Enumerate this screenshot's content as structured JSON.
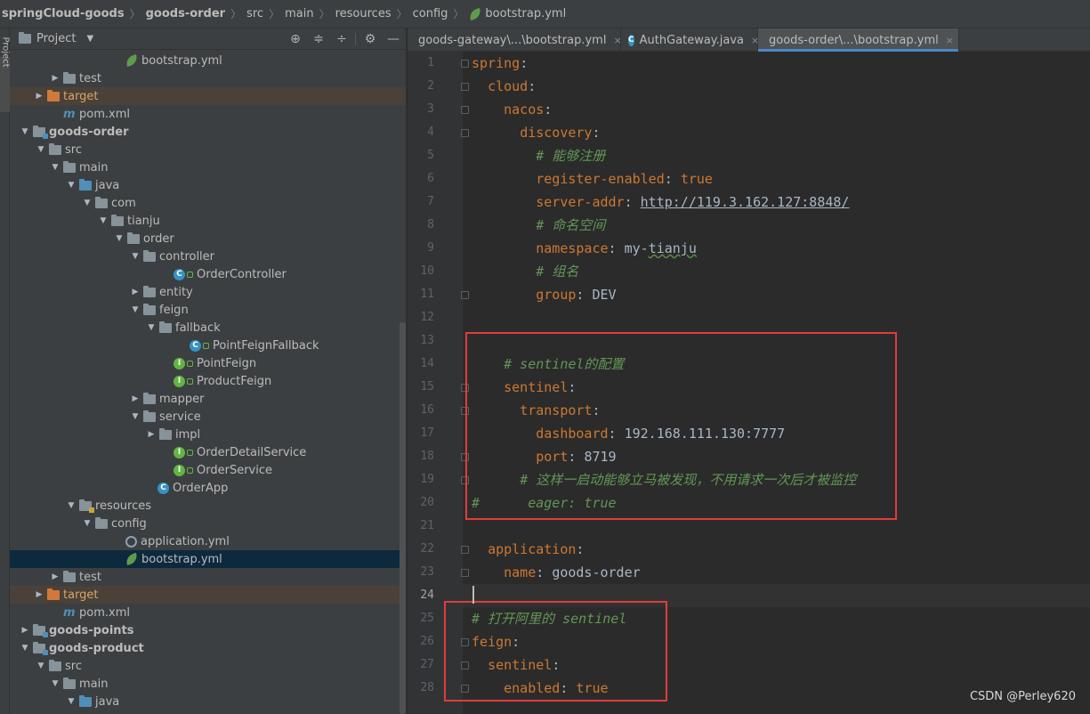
{
  "breadcrumb": [
    "springCloud-goods",
    "goods-order",
    "src",
    "main",
    "resources",
    "config",
    "bootstrap.yml"
  ],
  "tool_stripe": {
    "label": "Project"
  },
  "project_panel": {
    "title": "Project"
  },
  "tree": [
    {
      "label": "bootstrap.yml",
      "icon": "yml-icon"
    },
    {
      "label": "test",
      "icon": "folder-icon",
      "arrow": "▶"
    },
    {
      "label": "target",
      "icon": "folder-orange-icon",
      "arrow": "▶"
    },
    {
      "label": "pom.xml",
      "icon": "maven-icon"
    },
    {
      "label": "goods-order",
      "icon": "module-icon",
      "arrow": "▼"
    },
    {
      "label": "src",
      "icon": "folder-icon",
      "arrow": "▼"
    },
    {
      "label": "main",
      "icon": "folder-icon",
      "arrow": "▼"
    },
    {
      "label": "java",
      "icon": "folder-blue-icon",
      "arrow": "▼"
    },
    {
      "label": "com",
      "icon": "package-icon",
      "arrow": "▼"
    },
    {
      "label": "tianju",
      "icon": "package-icon",
      "arrow": "▼"
    },
    {
      "label": "order",
      "icon": "package-icon",
      "arrow": "▼"
    },
    {
      "label": "controller",
      "icon": "package-icon",
      "arrow": "▼"
    },
    {
      "label": "OrderController",
      "icon": "class-icon"
    },
    {
      "label": "entity",
      "icon": "package-icon",
      "arrow": "▶"
    },
    {
      "label": "feign",
      "icon": "package-icon",
      "arrow": "▼"
    },
    {
      "label": "fallback",
      "icon": "package-icon",
      "arrow": "▼"
    },
    {
      "label": "PointFeignFallback",
      "icon": "class-icon"
    },
    {
      "label": "PointFeign",
      "icon": "interface-icon"
    },
    {
      "label": "ProductFeign",
      "icon": "interface-icon"
    },
    {
      "label": "mapper",
      "icon": "package-icon",
      "arrow": "▶"
    },
    {
      "label": "service",
      "icon": "package-icon",
      "arrow": "▼"
    },
    {
      "label": "impl",
      "icon": "package-icon",
      "arrow": "▶"
    },
    {
      "label": "OrderDetailService",
      "icon": "interface-icon"
    },
    {
      "label": "OrderService",
      "icon": "interface-icon"
    },
    {
      "label": "OrderApp",
      "icon": "spring-boot-app-icon"
    },
    {
      "label": "resources",
      "icon": "resources-folder-icon",
      "arrow": "▼"
    },
    {
      "label": "config",
      "icon": "folder-icon",
      "arrow": "▼"
    },
    {
      "label": "application.yml",
      "icon": "app-yml-icon"
    },
    {
      "label": "bootstrap.yml",
      "icon": "yml-icon"
    },
    {
      "label": "test",
      "icon": "folder-icon",
      "arrow": "▶"
    },
    {
      "label": "target",
      "icon": "folder-orange-icon",
      "arrow": "▶"
    },
    {
      "label": "pom.xml",
      "icon": "maven-icon"
    },
    {
      "label": "goods-points",
      "icon": "module-icon",
      "arrow": "▶"
    },
    {
      "label": "goods-product",
      "icon": "module-icon",
      "arrow": "▼"
    },
    {
      "label": "src",
      "icon": "folder-icon",
      "arrow": "▼"
    },
    {
      "label": "main",
      "icon": "folder-icon",
      "arrow": "▼"
    },
    {
      "label": "java",
      "icon": "folder-blue-icon",
      "arrow": "▼"
    }
  ],
  "tabs": [
    {
      "label": "goods-gateway\\...\\bootstrap.yml",
      "icon": "yml-icon",
      "close": "×"
    },
    {
      "label": "AuthGateway.java",
      "icon": "class-icon",
      "close": "×"
    },
    {
      "label": "goods-order\\...\\bootstrap.yml",
      "icon": "yml-icon",
      "close": "×",
      "active": true
    }
  ],
  "code": [
    {
      "n": "1",
      "t": "spring:"
    },
    {
      "n": "2",
      "t": "  cloud:"
    },
    {
      "n": "3",
      "t": "    nacos:"
    },
    {
      "n": "4",
      "t": "      discovery:"
    },
    {
      "n": "5",
      "t": "        # 能够注册"
    },
    {
      "n": "6",
      "t": "        register-enabled: true"
    },
    {
      "n": "7",
      "t": "        server-addr: http://119.3.162.127:8848/"
    },
    {
      "n": "8",
      "t": "        # 命名空间"
    },
    {
      "n": "9",
      "t": "        namespace: my-tianju"
    },
    {
      "n": "10",
      "t": "        # 组名"
    },
    {
      "n": "11",
      "t": "        group: DEV"
    },
    {
      "n": "12",
      "t": ""
    },
    {
      "n": "13",
      "t": ""
    },
    {
      "n": "14",
      "t": "    # sentinel的配置"
    },
    {
      "n": "15",
      "t": "    sentinel:"
    },
    {
      "n": "16",
      "t": "      transport:"
    },
    {
      "n": "17",
      "t": "        dashboard: 192.168.111.130:7777"
    },
    {
      "n": "18",
      "t": "        port: 8719"
    },
    {
      "n": "19",
      "t": "      # 这样一启动能够立马被发现，不用请求一次后才被监控"
    },
    {
      "n": "20",
      "t": "#      eager: true"
    },
    {
      "n": "21",
      "t": ""
    },
    {
      "n": "22",
      "t": "  application:"
    },
    {
      "n": "23",
      "t": "    name: goods-order"
    },
    {
      "n": "24",
      "t": ""
    },
    {
      "n": "25",
      "t": "# 打开阿里的 sentinel"
    },
    {
      "n": "26",
      "t": "feign:"
    },
    {
      "n": "27",
      "t": "  sentinel:"
    },
    {
      "n": "28",
      "t": "    enabled: true"
    }
  ],
  "watermark": "CSDN @Perley620"
}
